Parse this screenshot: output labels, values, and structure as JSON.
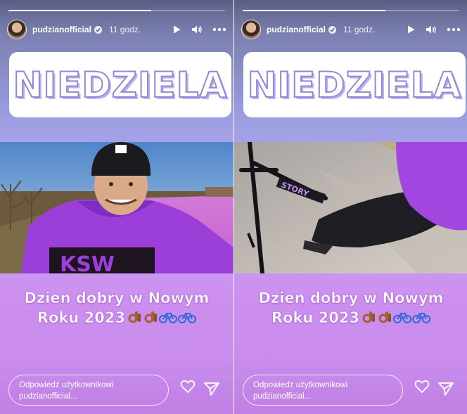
{
  "stories": [
    {
      "progress": 0.66,
      "username": "pudzianofficial",
      "time": "11 godz.",
      "title_sticker": "NIEDZIELA",
      "caption_line1": "Dzien dobry w Nowym",
      "caption_line2": "Roku 2023",
      "reply_line1": "Odpowiedz użytkownikowi",
      "reply_line2": "pudzianofficial...",
      "hoodie_text": "KSW"
    },
    {
      "progress": 0.66,
      "username": "pudzianofficial",
      "time": "11 godz.",
      "title_sticker": "NIEDZIELA",
      "caption_line1": "Dzien dobry w Nowym",
      "caption_line2": "Roku 2023",
      "reply_line1": "Odpowiedz użytkownikowi",
      "reply_line2": "pudzianofficial...",
      "bike_text": "STORY"
    }
  ],
  "icons": {
    "play": "play-icon",
    "volume": "volume-icon",
    "more": "more-icon",
    "verified": "verified-badge-icon",
    "heart": "heart-icon",
    "send": "send-icon",
    "ok_hand": "ok-hand-emoji",
    "bicycle": "bicycle-emoji"
  },
  "colors": {
    "accent_purple": "#c98ded",
    "title_outline": "#9088d8",
    "hoodie": "#9b3fd8"
  }
}
